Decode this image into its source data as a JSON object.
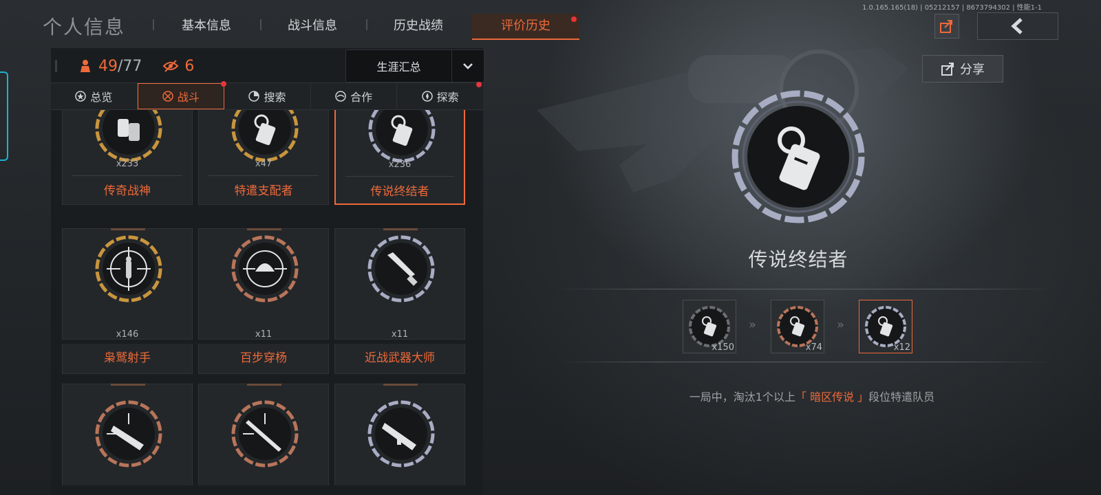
{
  "version": "1.0.165.165(18) | 05212157 | 8673794302 | 性能1-1",
  "page_title": "个人信息",
  "nav": [
    {
      "label": "基本信息",
      "active": false
    },
    {
      "label": "战斗信息",
      "active": false
    },
    {
      "label": "历史战绩",
      "active": false
    },
    {
      "label": "评价历史",
      "active": true
    }
  ],
  "share_label": "分享",
  "stats": {
    "achieved": "49",
    "total": "/77",
    "watch_count": "6"
  },
  "dropdown": {
    "selected": "生涯汇总"
  },
  "subtabs": [
    {
      "label": "总览",
      "active": false
    },
    {
      "label": "战斗",
      "active": true
    },
    {
      "label": "搜索",
      "active": false
    },
    {
      "label": "合作",
      "active": false
    },
    {
      "label": "探索",
      "active": false
    }
  ],
  "badges": [
    {
      "name": "传奇战神",
      "count": "x233",
      "tier": "gold",
      "icon": "dog-tags-icon"
    },
    {
      "name": "特遣支配者",
      "count": "x47",
      "tier": "gold",
      "icon": "dog-tag-icon"
    },
    {
      "name": "传说终结者",
      "count": "x236",
      "tier": "silver",
      "icon": "dog-tag-icon",
      "selected": true
    },
    {
      "name": "枭鹫射手",
      "count": "x146",
      "tier": "gold",
      "icon": "crosshair-soldier-icon"
    },
    {
      "name": "百步穿杨",
      "count": "x11",
      "tier": "bronze",
      "icon": "crosshair-helmet-icon"
    },
    {
      "name": "近战武器大师",
      "count": "x11",
      "tier": "silver",
      "icon": "knife-icon"
    },
    {
      "name": "",
      "count": "",
      "tier": "bronze",
      "icon": "smg-icon"
    },
    {
      "name": "",
      "count": "",
      "tier": "bronze",
      "icon": "rifle-icon"
    },
    {
      "name": "",
      "count": "",
      "tier": "silver",
      "icon": "assault-rifle-icon"
    }
  ],
  "detail": {
    "title": "传说终结者",
    "tiers": [
      {
        "count": "x150",
        "tier": "black"
      },
      {
        "count": "x74",
        "tier": "bronze"
      },
      {
        "count": "x12",
        "tier": "silver"
      }
    ],
    "desc_prefix": "一局中，淘汰1个以上",
    "desc_highlight": "「 暗区传说 」",
    "desc_suffix": "段位特遣队员"
  },
  "colors": {
    "accent": "#ef6a3a",
    "gold": "#c9963e",
    "silver": "#a8adc4",
    "bronze": "#b8755a",
    "notify": "#e8353b"
  }
}
